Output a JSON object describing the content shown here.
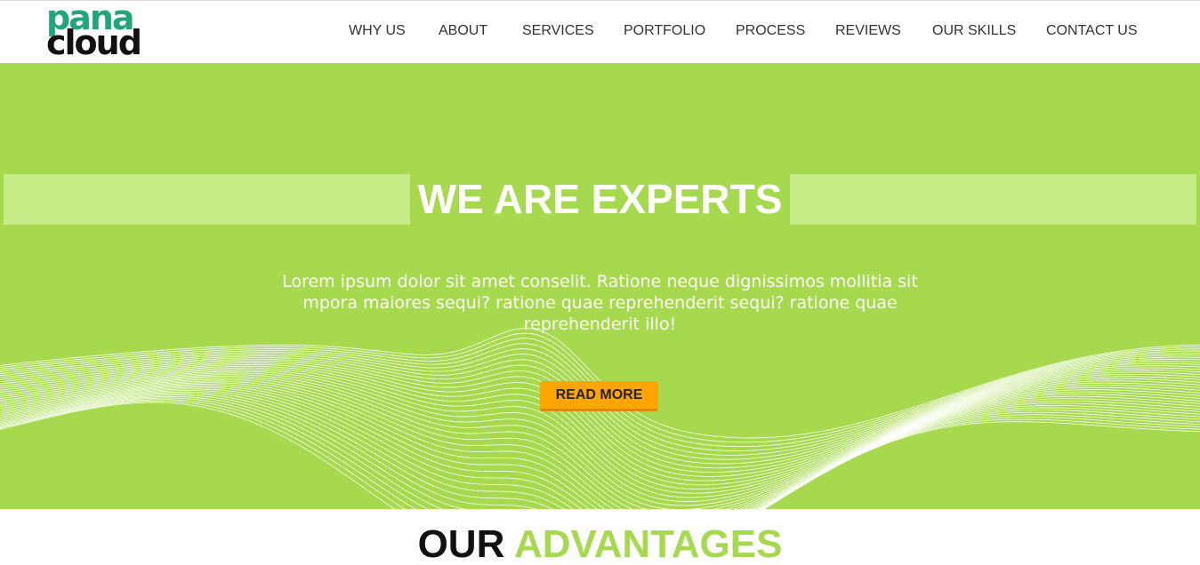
{
  "brand": {
    "logo_line1": "pana",
    "logo_line2": "cloud",
    "primary_color": "#a6d94d",
    "logo_green": "#1fa67a"
  },
  "nav": {
    "items": [
      {
        "label": "WHY US"
      },
      {
        "label": "ABOUT"
      },
      {
        "label": "SERVICES"
      },
      {
        "label": "PORTFOLIO"
      },
      {
        "label": "PROCESS"
      },
      {
        "label": "REVIEWS"
      },
      {
        "label": "OUR SKILLS"
      },
      {
        "label": "CONTACT US"
      }
    ]
  },
  "hero": {
    "title": "WE ARE EXPERTS",
    "text": "Lorem ipsum dolor sit amet conselit. Ratione neque dignissimos mollitia sit mpora maiores sequi? ratione quae reprehenderit sequi? ratione quae reprehenderit illo!",
    "button_label": "READ MORE",
    "button_color": "#ffa500"
  },
  "advantages": {
    "title_part1": "OUR",
    "title_part2": "ADVANTAGES"
  }
}
